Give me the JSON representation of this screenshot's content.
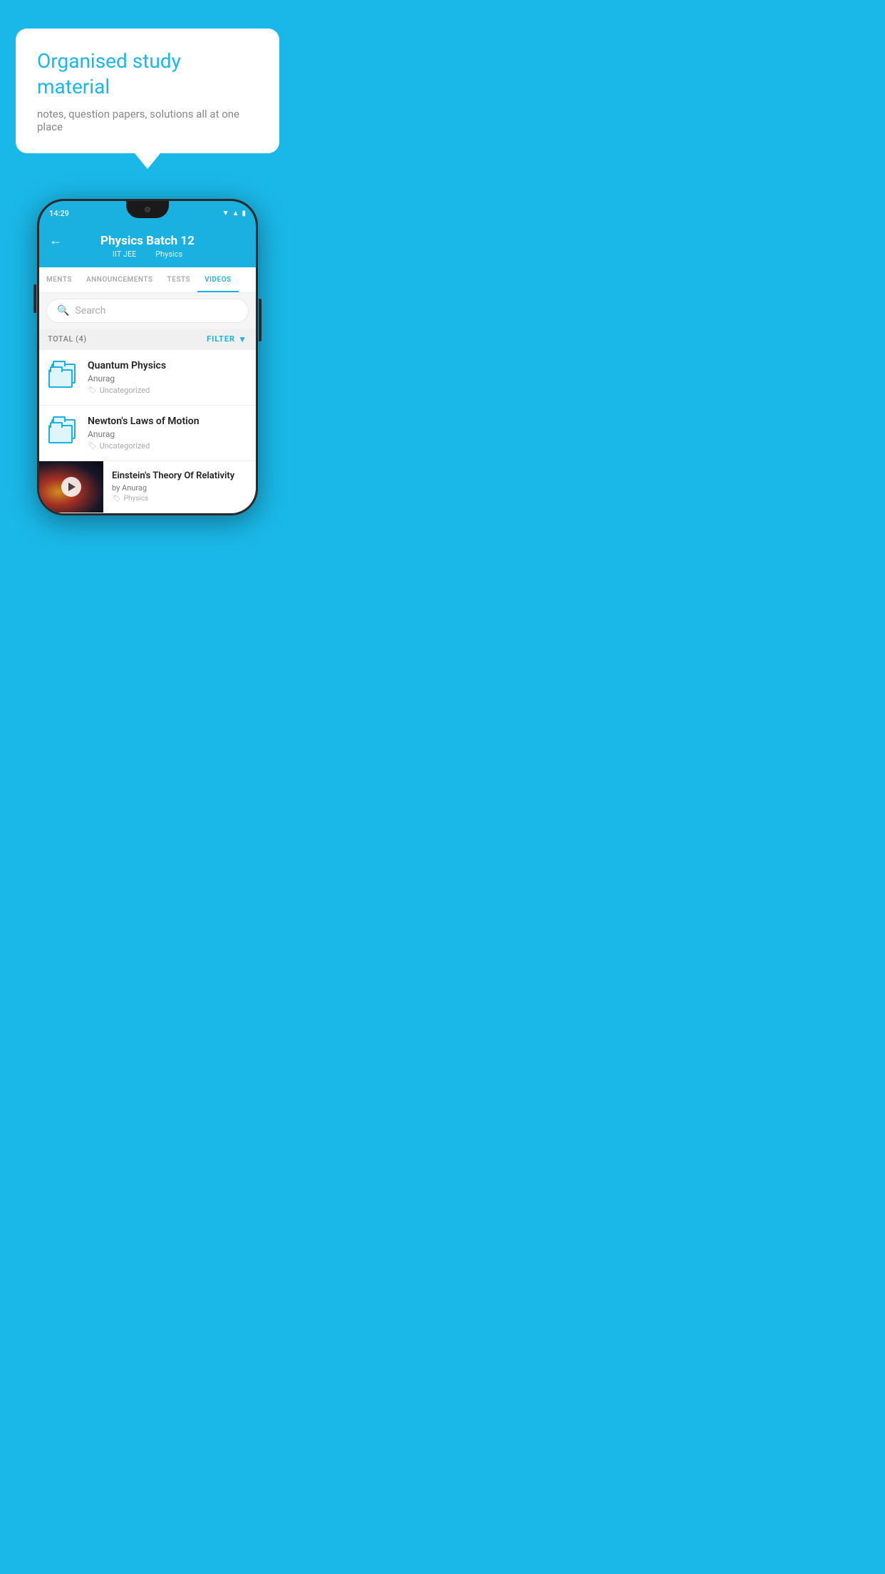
{
  "app": {
    "background_color": "#1ab8e8"
  },
  "speech_bubble": {
    "title": "Organised study material",
    "subtitle": "notes, question papers, solutions all at one place"
  },
  "phone": {
    "status_bar": {
      "time": "14:29",
      "icons": [
        "wifi",
        "signal",
        "battery"
      ]
    },
    "header": {
      "back_label": "←",
      "title": "Physics Batch 12",
      "subtitle_part1": "IIT JEE",
      "subtitle_part2": "Physics"
    },
    "tabs": [
      {
        "label": "MENTS",
        "active": false
      },
      {
        "label": "ANNOUNCEMENTS",
        "active": false
      },
      {
        "label": "TESTS",
        "active": false
      },
      {
        "label": "VIDEOS",
        "active": true
      }
    ],
    "search": {
      "placeholder": "Search"
    },
    "filter_bar": {
      "total_label": "TOTAL (4)",
      "filter_label": "FILTER"
    },
    "videos": [
      {
        "id": 1,
        "title": "Quantum Physics",
        "author": "Anurag",
        "tag": "Uncategorized",
        "has_thumbnail": false
      },
      {
        "id": 2,
        "title": "Newton's Laws of Motion",
        "author": "Anurag",
        "tag": "Uncategorized",
        "has_thumbnail": false
      },
      {
        "id": 3,
        "title": "Einstein's Theory Of Relativity",
        "author": "by Anurag",
        "tag": "Physics",
        "has_thumbnail": true
      }
    ]
  }
}
